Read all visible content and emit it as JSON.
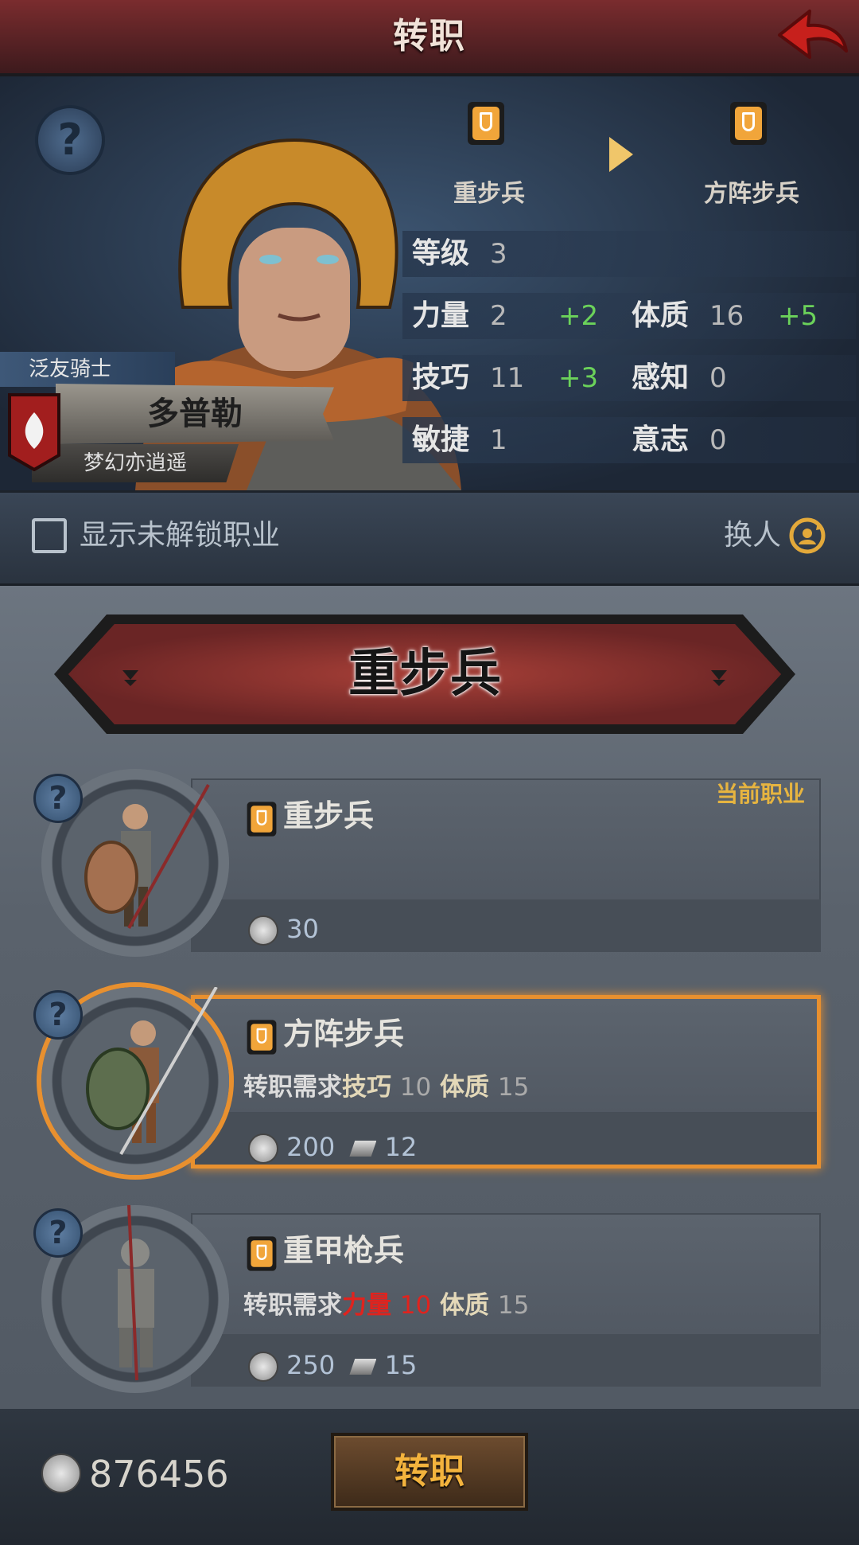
{
  "topbar": {
    "title": "转职"
  },
  "header": {
    "title_tag": "泛友骑士",
    "hero_name": "多普勒",
    "guild": "梦幻亦逍遥",
    "from_class": "重步兵",
    "to_class": "方阵步兵",
    "stats": {
      "level_label": "等级",
      "level": "3",
      "str_label": "力量",
      "str": "2",
      "str_plus": "+2",
      "con_label": "体质",
      "con": "16",
      "con_plus": "+5",
      "skill_label": "技巧",
      "skill": "11",
      "skill_plus": "+3",
      "per_label": "感知",
      "per": "0",
      "agi_label": "敏捷",
      "agi": "1",
      "will_label": "意志",
      "will": "0"
    }
  },
  "options": {
    "show_locked": "显示未解锁职业",
    "swap": "换人"
  },
  "banner": {
    "title": "重步兵"
  },
  "current_tag": "当前职业",
  "classes": [
    {
      "name": "重步兵",
      "cost": "30"
    },
    {
      "name": "方阵步兵",
      "req_prefix": "转职需求",
      "req1_name": "技巧",
      "req1_val": "10",
      "req2_name": "体质",
      "req2_val": "15",
      "cost": "200",
      "mat": "12"
    },
    {
      "name": "重甲枪兵",
      "req_prefix": "转职需求",
      "req1_name": "力量",
      "req1_val": "10",
      "req2_name": "体质",
      "req2_val": "15",
      "cost": "250",
      "mat": "15"
    }
  ],
  "footer": {
    "money": "876456",
    "transfer_button": "转职"
  },
  "colors": {
    "accent": "#e8902f",
    "positive": "#6bd25a",
    "insufficient": "#e0231e",
    "gold": "#e6b440"
  }
}
